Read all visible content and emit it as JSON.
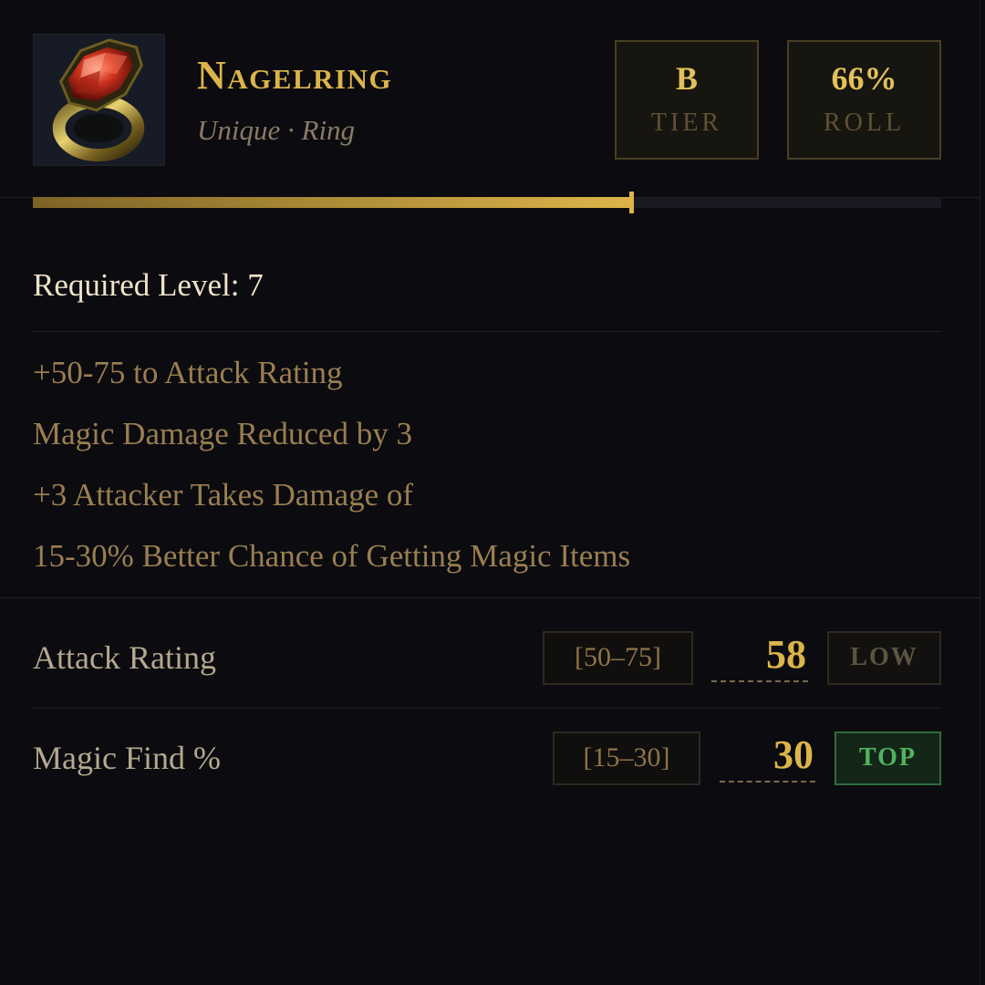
{
  "item": {
    "name": "Nagelring",
    "type": "Unique · Ring",
    "icon": "ring-icon"
  },
  "badges": {
    "tier_value": "B",
    "tier_label": "TIER",
    "roll_value": "66%",
    "roll_label": "ROLL"
  },
  "roll_progress": 0.66,
  "requirement": "Required Level: 7",
  "properties": [
    "+50-75 to Attack Rating",
    "Magic Damage Reduced by 3",
    "+3 Attacker Takes Damage of",
    "15-30% Better Chance of Getting Magic Items"
  ],
  "stats": [
    {
      "label": "Attack Rating",
      "range": "[50–75]",
      "value": "58",
      "quality": "LOW"
    },
    {
      "label": "Magic Find %",
      "range": "[15–30]",
      "value": "30",
      "quality": "TOP"
    }
  ],
  "colors": {
    "gold": "#dcb449",
    "background": "#0b0b10",
    "top_green": "#52b35e"
  }
}
